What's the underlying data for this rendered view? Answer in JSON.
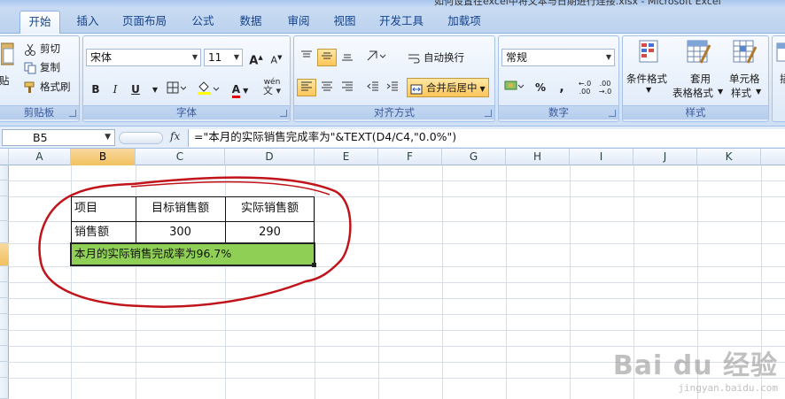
{
  "window": {
    "title": "如何设置在excel中将文本与日期进行连接.xlsx - Microsoft Excel"
  },
  "tabs": [
    "开始",
    "插入",
    "页面布局",
    "公式",
    "数据",
    "审阅",
    "视图",
    "开发工具",
    "加载项"
  ],
  "clipboard": {
    "paste": "贴",
    "cut": "剪切",
    "copy": "复制",
    "format_painter": "格式刷",
    "label": "剪贴板"
  },
  "font": {
    "name": "宋体",
    "size": "11",
    "bold": "B",
    "italic": "I",
    "underline": "U",
    "grow": "A",
    "shrink": "A",
    "color_letter": "A",
    "phonetic": "wén",
    "label": "字体"
  },
  "alignment": {
    "wrap": "自动换行",
    "merge": "合并后居中",
    "label": "对齐方式"
  },
  "number": {
    "format": "常规",
    "percent": "%",
    "comma": ",",
    "label": "数字"
  },
  "styles": {
    "conditional": "条件格式",
    "table_line1": "套用",
    "table_line2": "表格格式",
    "cell_line1": "单元格",
    "cell_line2": "样式",
    "label": "样式",
    "extra": "插"
  },
  "formula_bar": {
    "name_box": "B5",
    "fx": "fx",
    "formula": "=\"本月的实际销售完成率为\"&TEXT(D4/C4,\"0.0%\")"
  },
  "columns": [
    "A",
    "B",
    "C",
    "D",
    "E",
    "F",
    "G",
    "H",
    "I",
    "J",
    "K"
  ],
  "selected_column": "B",
  "table": {
    "header": [
      "项目",
      "目标销售额",
      "实际销售额"
    ],
    "row": [
      "销售额",
      "300",
      "290"
    ],
    "result": "本月的实际销售完成率为96.7%"
  },
  "colors": {
    "selection_fill": "#8fcf56",
    "annotation_ring": "#c0141a",
    "header_highlight": "#f1c15f"
  },
  "watermark": {
    "brand": "Bai du 经验",
    "url": "jingyan.baidu.com"
  }
}
